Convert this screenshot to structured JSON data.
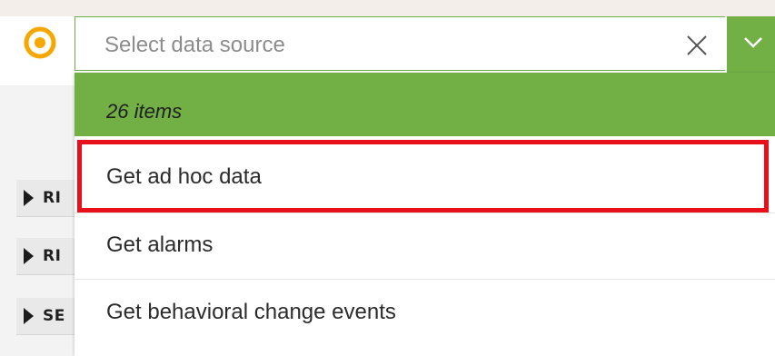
{
  "header": {
    "logo_icon": "target-circle-icon"
  },
  "select": {
    "placeholder": "Select data source",
    "clear_icon": "close-icon",
    "toggle_icon": "chevron-down-icon",
    "accent_color": "#72b046"
  },
  "dropdown": {
    "count_label": "26 items",
    "options": [
      {
        "label": "Get ad hoc data",
        "highlighted": true
      },
      {
        "label": "Get alarms",
        "highlighted": false
      },
      {
        "label": "Get behavioral change events",
        "highlighted": false
      }
    ],
    "highlight_color": "#e8101b"
  },
  "tree": {
    "rows": [
      {
        "label": "RI"
      },
      {
        "label": "RI"
      },
      {
        "label": "SE"
      }
    ]
  }
}
